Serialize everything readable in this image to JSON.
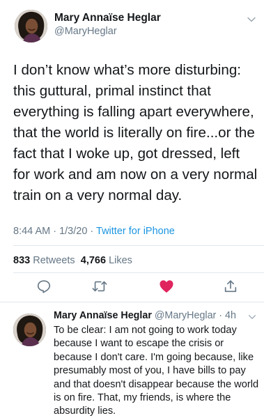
{
  "tweet": {
    "author_name": "Mary Annaïse Heglar",
    "author_handle": "@MaryHeglar",
    "text": "I don’t know what’s more disturbing: this guttural, primal instinct that everything is falling apart everywhere, that the world is literally on fire...or the fact that I woke up, got dressed, left for work and am now on a very normal train on a very normal day.",
    "time": "8:44 AM · 1/3/20 · ",
    "source": "Twitter for iPhone",
    "retweets_count": "833",
    "retweets_label": "Retweets",
    "likes_count": "4,766",
    "likes_label": "Likes",
    "liked": true
  },
  "actions": {
    "reply_icon": "reply-icon",
    "retweet_icon": "retweet-icon",
    "like_icon": "heart-icon",
    "share_icon": "share-icon"
  },
  "reply": {
    "author_name": "Mary Annaïse Heglar",
    "author_handle": "@MaryHeglar · 4h",
    "text": "To be clear: I am not going to work today because I want to escape the crisis or because I don't care. I'm going because, like presumably most of you, I have bills to pay and that doesn't disappear because the world is on fire. That, my friends, is where the absurdity lies."
  },
  "colors": {
    "accent": "#1b95e0",
    "muted": "#657786",
    "like": "#e0245e",
    "divider": "#e1e8ed"
  }
}
